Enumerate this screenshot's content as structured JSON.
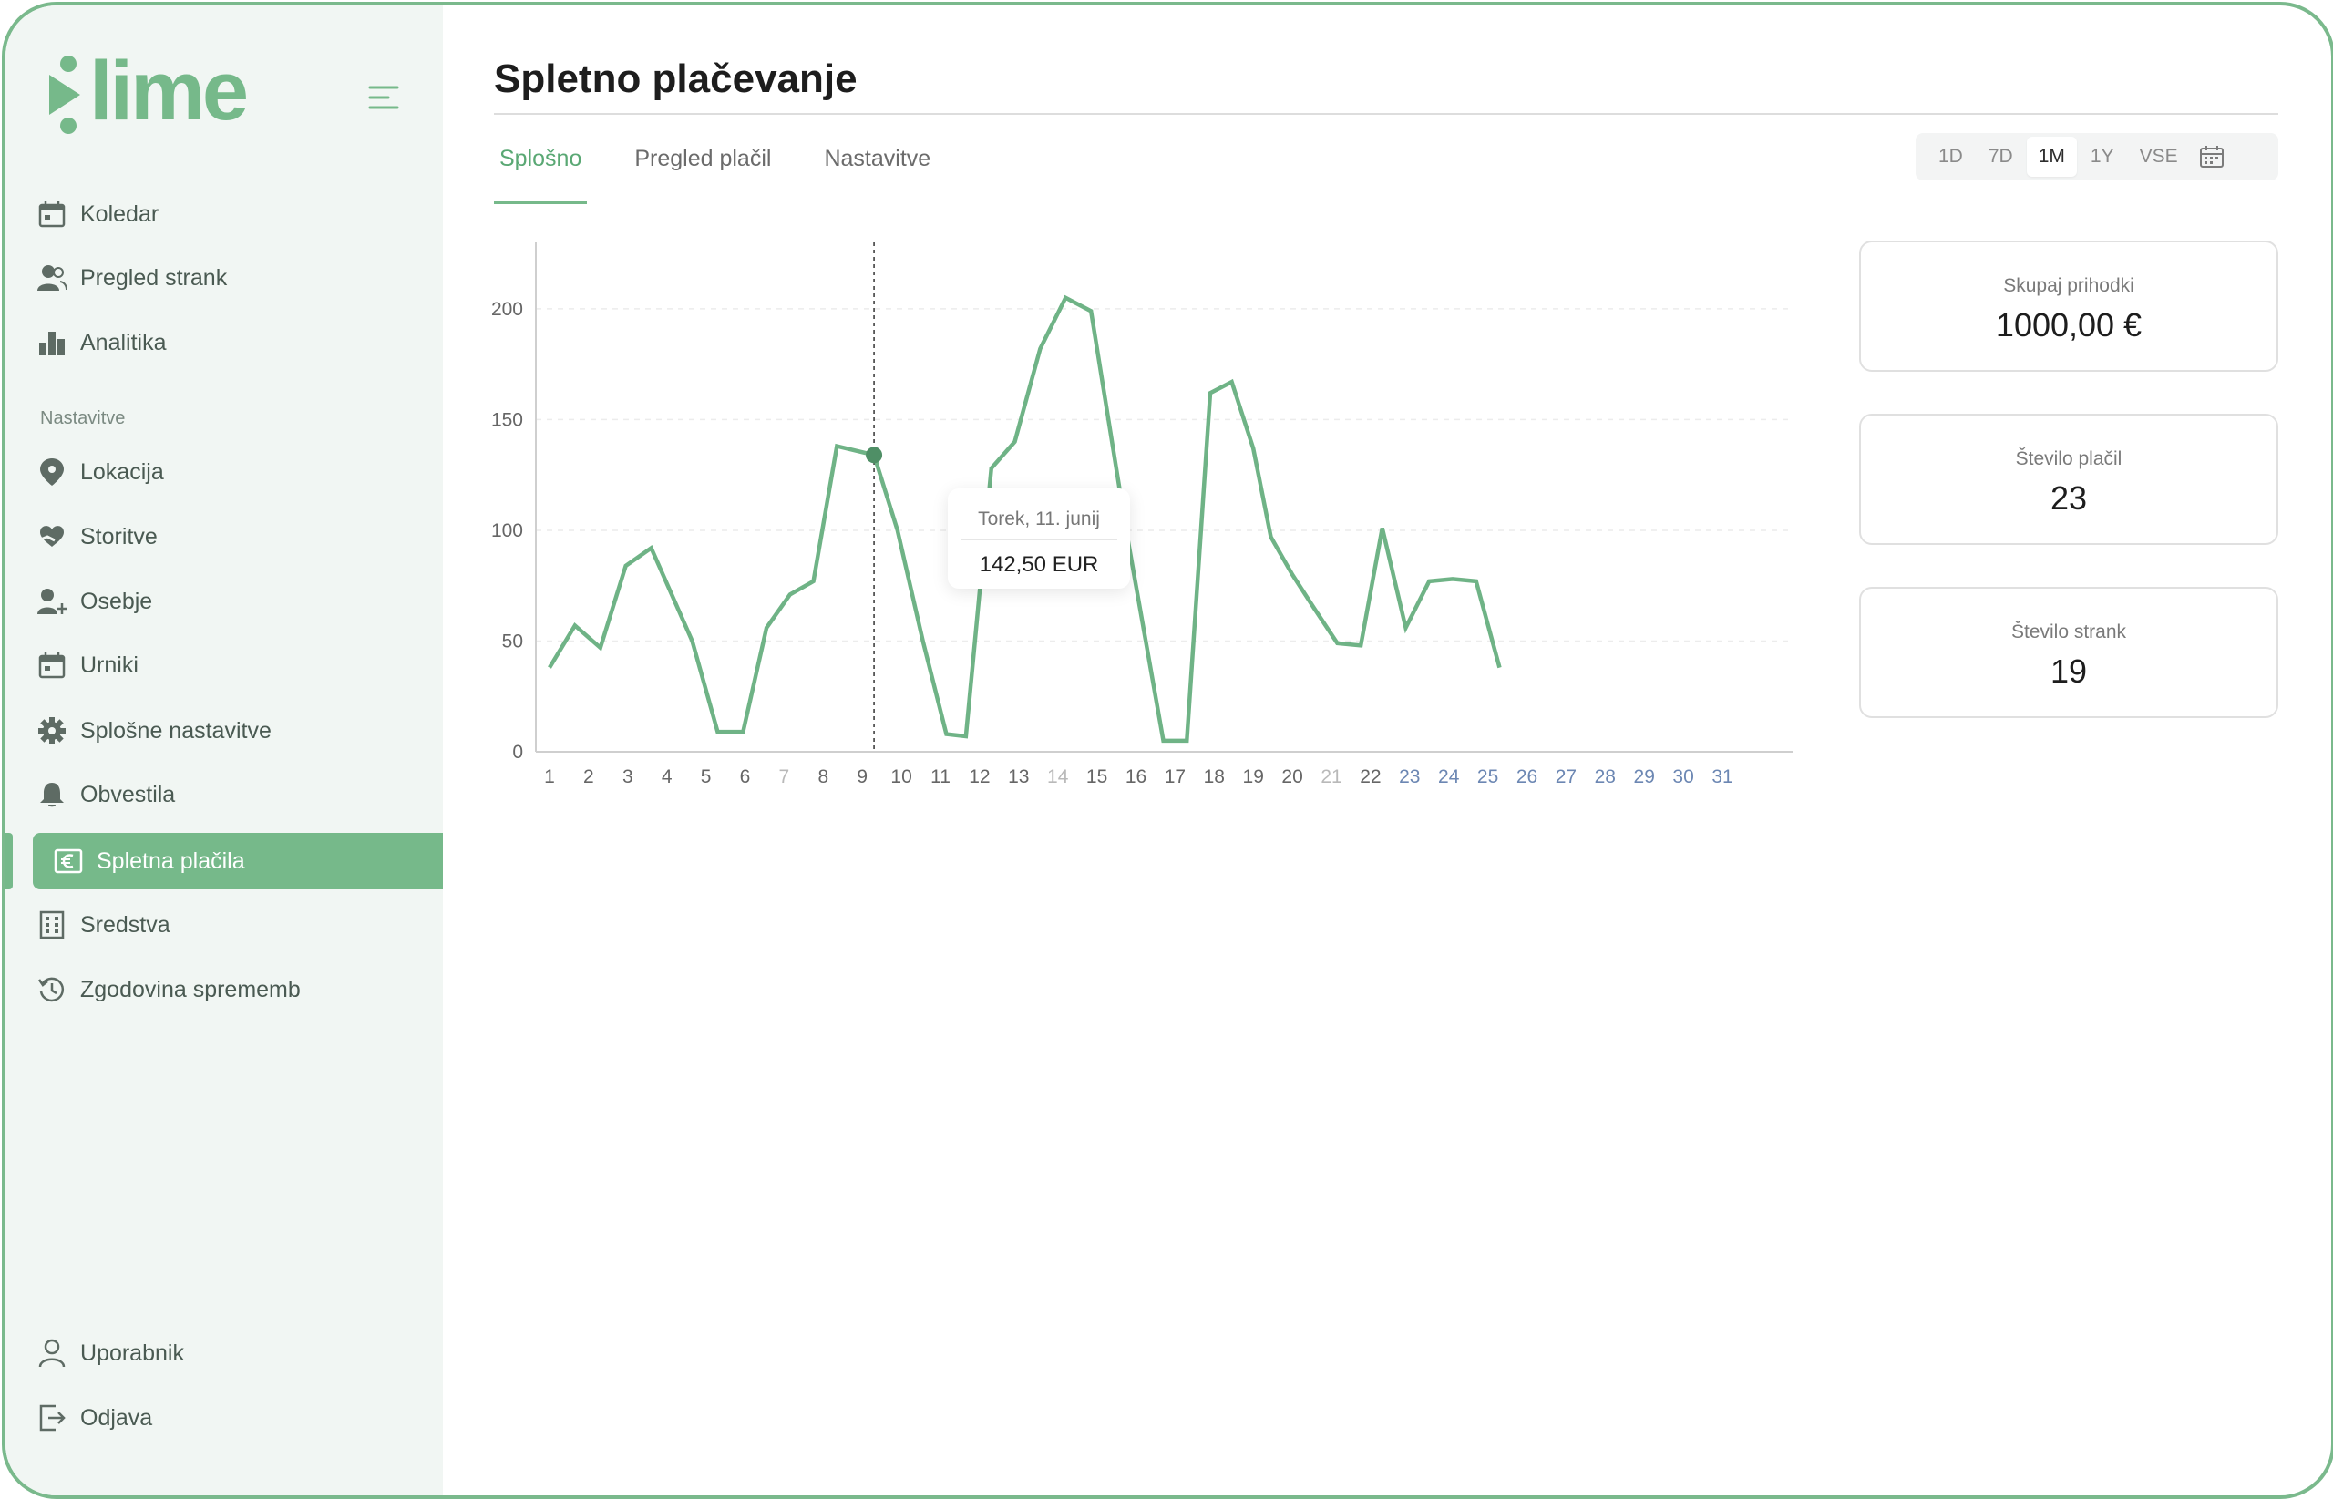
{
  "brand": {
    "name": "lime",
    "color": "#76b98a"
  },
  "sidebar": {
    "items": [
      {
        "label": "Koledar",
        "icon": "calendar-icon"
      },
      {
        "label": "Pregled strank",
        "icon": "users-icon"
      },
      {
        "label": "Analitika",
        "icon": "bar-chart-icon"
      }
    ],
    "section_label": "Nastavitve",
    "settings_items": [
      {
        "label": "Lokacija",
        "icon": "location-pin-icon"
      },
      {
        "label": "Storitve",
        "icon": "heart-hand-icon"
      },
      {
        "label": "Osebje",
        "icon": "user-add-icon"
      },
      {
        "label": "Urniki",
        "icon": "calendar-icon"
      },
      {
        "label": "Splošne nastavitve",
        "icon": "gear-icon"
      },
      {
        "label": "Obvestila",
        "icon": "bell-icon"
      },
      {
        "label": "Spletna plačila",
        "icon": "euro-card-icon",
        "active": true
      },
      {
        "label": "Sredstva",
        "icon": "building-icon"
      },
      {
        "label": "Zgodovina sprememb",
        "icon": "history-icon"
      }
    ],
    "footer_items": [
      {
        "label": "Uporabnik",
        "icon": "user-icon"
      },
      {
        "label": "Odjava",
        "icon": "logout-icon"
      }
    ]
  },
  "page": {
    "title": "Spletno plačevanje",
    "tabs": [
      {
        "label": "Splošno",
        "active": true
      },
      {
        "label": "Pregled plačil"
      },
      {
        "label": "Nastavitve"
      }
    ],
    "range": {
      "options": [
        "1D",
        "7D",
        "1M",
        "1Y",
        "VSE"
      ],
      "selected": "1M"
    }
  },
  "tooltip": {
    "date": "Torek, 11. junij",
    "value": "142,50 EUR"
  },
  "stats": [
    {
      "label": "Skupaj prihodki",
      "value": "1000,00 €"
    },
    {
      "label": "Število plačil",
      "value": "23"
    },
    {
      "label": "Število strank",
      "value": "19"
    }
  ],
  "chart_data": {
    "type": "line",
    "x": [
      1,
      1.5,
      2,
      2.5,
      3,
      3.5,
      4,
      4.5,
      5,
      5.5,
      6,
      6.5,
      7,
      7.5,
      8,
      8.5,
      9,
      9.5,
      10,
      10.5,
      11,
      11.5,
      12,
      12.5,
      13,
      13.5,
      14,
      14.5,
      15,
      15.5,
      16,
      16.5,
      17,
      17.5,
      18,
      18.5,
      19,
      19.5,
      20,
      20.5,
      21,
      21.5,
      22,
      22.5,
      23,
      23.5,
      24,
      24.5,
      25,
      25.5,
      26,
      26.5,
      27,
      27.5,
      28,
      28.5,
      29,
      29.5,
      30,
      30.5,
      31
    ],
    "values": [
      38,
      57,
      47,
      84,
      92,
      50,
      9,
      9,
      56,
      71,
      77,
      138,
      134,
      100,
      50,
      8,
      7,
      128,
      140,
      182,
      205,
      199,
      100,
      5,
      5,
      162,
      167,
      137,
      97,
      80,
      65,
      49,
      48,
      101,
      56,
      77,
      78,
      77,
      38
    ],
    "x_values": [
      1,
      1.65,
      2.3,
      2.95,
      3.6,
      4.65,
      5.3,
      5.95,
      6.55,
      7.15,
      7.75,
      8.35,
      9.3,
      9.9,
      10.55,
      11.15,
      11.65,
      12.3,
      12.9,
      13.55,
      14.2,
      14.85,
      15.75,
      16.7,
      17.3,
      17.9,
      18.45,
      19.0,
      19.45,
      20.0,
      20.55,
      21.15,
      21.75,
      22.3,
      22.9,
      23.5,
      24.1,
      24.7,
      25.3
    ],
    "highlight": {
      "x": 9.3,
      "y": 134
    },
    "x_ticks": [
      "1",
      "2",
      "3",
      "4",
      "5",
      "6",
      "7",
      "8",
      "9",
      "10",
      "11",
      "12",
      "13",
      "14",
      "15",
      "16",
      "17",
      "18",
      "19",
      "20",
      "21",
      "22",
      "23",
      "24",
      "25",
      "26",
      "27",
      "28",
      "29",
      "30",
      "31"
    ],
    "weekend_ticks": [
      "7",
      "14",
      "21"
    ],
    "future_ticks": [
      "23",
      "24",
      "25",
      "26",
      "27",
      "28",
      "29",
      "30",
      "31"
    ],
    "y_ticks": [
      0,
      50,
      100,
      150,
      200
    ],
    "ylim": [
      0,
      230
    ],
    "grid": true,
    "line_color": "#6fb386",
    "highlight_color": "#4f8f66",
    "weekend_tick_color": "#b9b9b9",
    "future_tick_color": "#6c87b3"
  }
}
